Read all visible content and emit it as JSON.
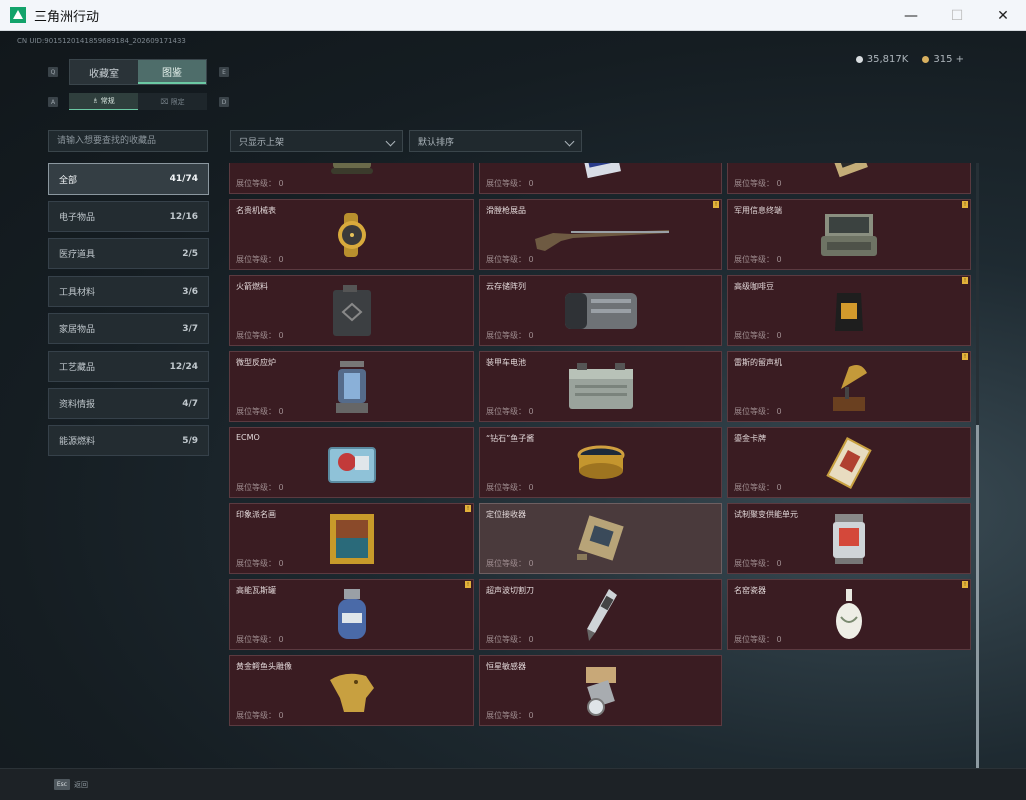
{
  "window": {
    "title": "三角洲行动",
    "minimize": "—",
    "maximize": "☐",
    "close": "✕"
  },
  "uid": "CN UID:9015120141859689184_202609171433",
  "currency": [
    {
      "value": "35,817K",
      "color": "#d8dde0"
    },
    {
      "value": "315 +",
      "color": "#d8b060"
    }
  ],
  "tabs": [
    {
      "label": "收藏室",
      "active": false
    },
    {
      "label": "图鉴",
      "active": true
    }
  ],
  "hotkeys": {
    "tab_prev": "Q",
    "tab_next": "E",
    "sub_prev": "A",
    "sub_next": "D"
  },
  "subtabs": [
    {
      "label": "♗ 常规",
      "active": true
    },
    {
      "label": "⌧ 限定",
      "active": false
    }
  ],
  "search": {
    "placeholder": "请输入想要查找的收藏品"
  },
  "filters": {
    "shelf": "只显示上架",
    "sort": "默认排序"
  },
  "categories": [
    {
      "label": "全部",
      "count": "41/74",
      "active": true
    },
    {
      "label": "电子物品",
      "count": "12/16",
      "active": false
    },
    {
      "label": "医疗道具",
      "count": "2/5",
      "active": false
    },
    {
      "label": "工具材料",
      "count": "3/6",
      "active": false
    },
    {
      "label": "家居物品",
      "count": "3/7",
      "active": false
    },
    {
      "label": "工艺藏品",
      "count": "12/24",
      "active": false
    },
    {
      "label": "资料情报",
      "count": "4/7",
      "active": false
    },
    {
      "label": "能源燃料",
      "count": "5/9",
      "active": false
    }
  ],
  "level_label": "展位等级：",
  "items": [
    {
      "name": "",
      "level": "0",
      "badge": false,
      "icon": "tank-model-icon"
    },
    {
      "name": "",
      "level": "0",
      "badge": false,
      "icon": "circuit-card-icon"
    },
    {
      "name": "",
      "level": "0",
      "badge": false,
      "icon": "gold-device-icon"
    },
    {
      "name": "名贵机械表",
      "level": "0",
      "badge": false,
      "icon": "gold-watch-icon"
    },
    {
      "name": "滑膛枪展品",
      "level": "0",
      "badge": true,
      "icon": "musket-icon"
    },
    {
      "name": "军用信息终端",
      "level": "0",
      "badge": true,
      "icon": "military-terminal-icon"
    },
    {
      "name": "火箭燃料",
      "level": "0",
      "badge": false,
      "icon": "fuel-canister-icon"
    },
    {
      "name": "云存储阵列",
      "level": "0",
      "badge": false,
      "icon": "storage-array-icon"
    },
    {
      "name": "高级咖啡豆",
      "level": "0",
      "badge": true,
      "icon": "coffee-bag-icon"
    },
    {
      "name": "微型反应炉",
      "level": "0",
      "badge": false,
      "icon": "mini-reactor-icon"
    },
    {
      "name": "装甲车电池",
      "level": "0",
      "badge": false,
      "icon": "vehicle-battery-icon"
    },
    {
      "name": "雷斯的留声机",
      "level": "0",
      "badge": true,
      "icon": "gramophone-icon"
    },
    {
      "name": "ECMO",
      "level": "0",
      "badge": false,
      "icon": "ecmo-machine-icon"
    },
    {
      "name": "“钻石”鱼子酱",
      "level": "0",
      "badge": false,
      "icon": "caviar-tin-icon"
    },
    {
      "name": "鎏金卡牌",
      "level": "0",
      "badge": false,
      "icon": "gilded-card-icon"
    },
    {
      "name": "印象派名画",
      "level": "0",
      "badge": true,
      "icon": "framed-painting-icon"
    },
    {
      "name": "定位接收器",
      "level": "0",
      "badge": false,
      "icon": "locator-receiver-icon",
      "highlight": true
    },
    {
      "name": "试制聚变供能单元",
      "level": "0",
      "badge": false,
      "icon": "fusion-unit-icon"
    },
    {
      "name": "高能瓦斯罐",
      "level": "0",
      "badge": true,
      "icon": "gas-cylinder-icon"
    },
    {
      "name": "超声波切割刀",
      "level": "0",
      "badge": false,
      "icon": "ultrasonic-cutter-icon"
    },
    {
      "name": "名窑瓷器",
      "level": "0",
      "badge": true,
      "icon": "porcelain-vase-icon"
    },
    {
      "name": "黄金鳄鱼头雕像",
      "level": "0",
      "badge": false,
      "icon": "gold-crocodile-statue-icon"
    },
    {
      "name": "恒星敏感器",
      "level": "0",
      "badge": false,
      "icon": "star-sensor-icon"
    }
  ],
  "badge_glyph": "!",
  "footer": {
    "esc_key": "Esc",
    "esc_label": "返回"
  }
}
